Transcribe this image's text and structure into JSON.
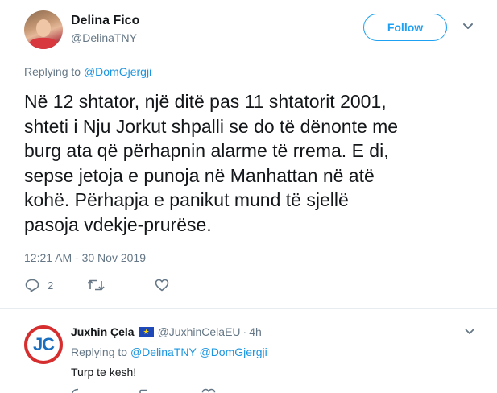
{
  "tweet": {
    "author_name": "Delina Fico",
    "author_handle": "@DelinaTNY",
    "follow_label": "Follow",
    "replying_prefix": "Replying to",
    "replying_to": "@DomGjergji",
    "text": "Në 12 shtator, një ditë pas 11 shtatorit 2001,\nshteti i Nju Jorkut shpalli se do të dënonte me\nburg ata që përhapnin alarme të rrema. E di,\nsepse jetoja e punoja në Manhattan në atë\nkohë. Përhapja e panikut mund të sjellë\npasoja vdekje-prurëse.",
    "timestamp": "12:21 AM - 30 Nov 2019",
    "reply_count": "2",
    "icons": [
      "reply-icon",
      "retweet-icon",
      "like-icon",
      "chevron-down-icon"
    ]
  },
  "reply": {
    "author_name": "Juxhin Çela",
    "flag_icon": "eu-flag-icon",
    "author_handle": "@JuxhinCelaEU",
    "separator": "·",
    "age": "4h",
    "replying_prefix": "Replying to",
    "replying_to_1": "@DelinaTNY",
    "replying_to_2": "@DomGjergji",
    "text": "Turp te kesh!"
  },
  "colors": {
    "accent": "#1da1f2",
    "link": "#1b95e0",
    "muted": "#657786",
    "divider": "#e6ecf0"
  }
}
